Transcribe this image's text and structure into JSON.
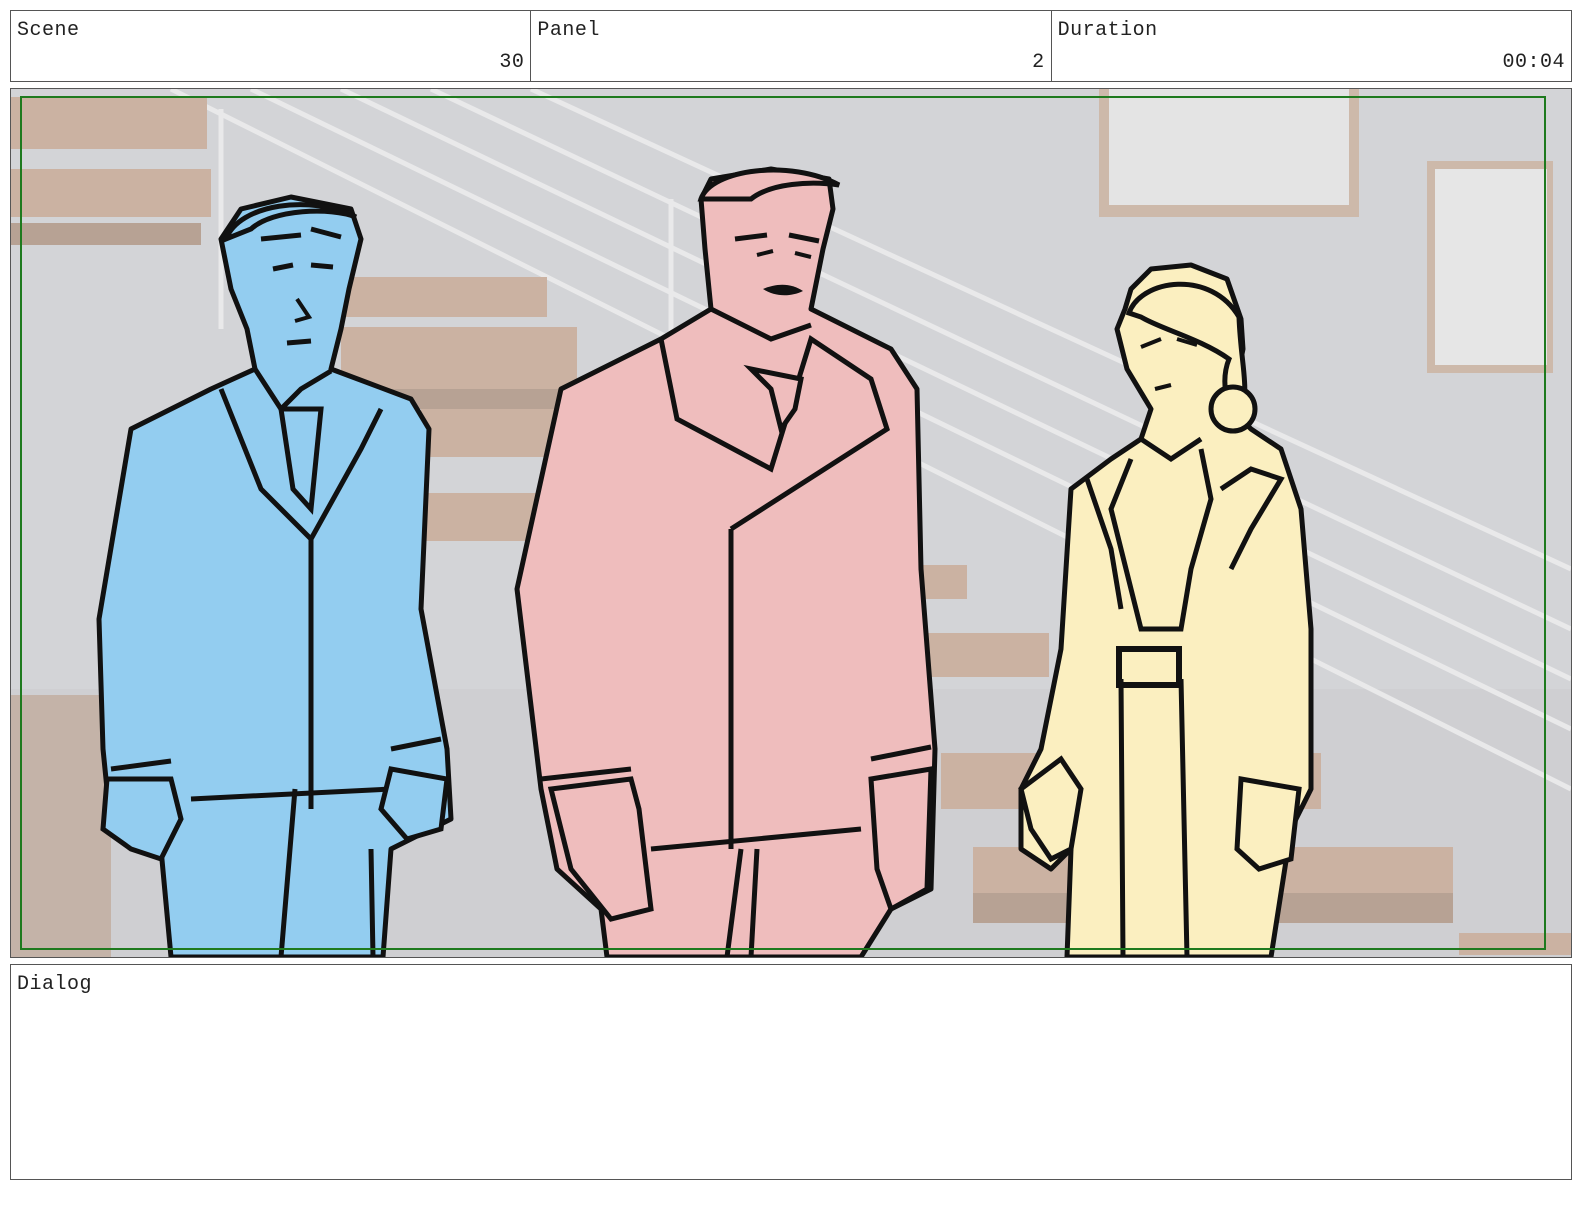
{
  "header": {
    "scene_label": "Scene",
    "scene_value": "30",
    "panel_label": "Panel",
    "panel_value": "2",
    "duration_label": "Duration",
    "duration_value": "00:04"
  },
  "panel": {
    "safe_area_color": "#1e7a1e",
    "characters": [
      {
        "id": "man-left",
        "color": "#93cdf0"
      },
      {
        "id": "man-center",
        "color": "#efbdbd"
      },
      {
        "id": "woman-right",
        "color": "#fbefc0"
      }
    ]
  },
  "dialog": {
    "label": "Dialog",
    "text": ""
  }
}
